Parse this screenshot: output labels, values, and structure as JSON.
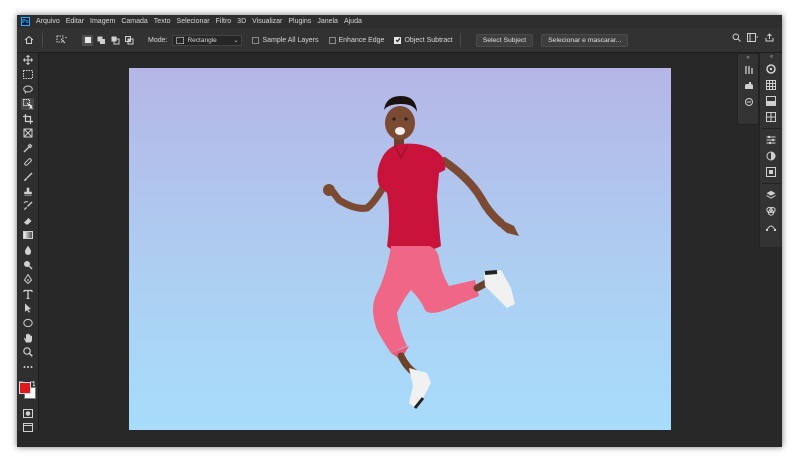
{
  "app": {
    "logo_text": "Ps",
    "accent": "#31a8ff"
  },
  "menubar": {
    "items": [
      "Arquivo",
      "Editar",
      "Imagem",
      "Camada",
      "Texto",
      "Selecionar",
      "Filtro",
      "3D",
      "Visualizar",
      "Plugins",
      "Janela",
      "Ajuda"
    ]
  },
  "options": {
    "mode_label": "Mode:",
    "mode_value": "Rectangle",
    "sample_all_layers": {
      "label": "Sample All Layers",
      "checked": false
    },
    "enhance_edge": {
      "label": "Enhance Edge",
      "checked": false
    },
    "object_subtract": {
      "label": "Object Subtract",
      "checked": true
    },
    "select_subject_label": "Select Subject",
    "select_mask_label": "Selecionar e mascarar..."
  },
  "toolbar": {
    "tools": [
      "move-icon",
      "marquee-icon",
      "lasso-icon",
      "object-selection-icon",
      "crop-icon",
      "frame-icon",
      "eyedropper-icon",
      "healing-brush-icon",
      "brush-icon",
      "clone-stamp-icon",
      "history-brush-icon",
      "eraser-icon",
      "gradient-icon",
      "blur-icon",
      "dodge-icon",
      "pen-icon",
      "type-icon",
      "path-selection-icon",
      "ellipse-icon",
      "hand-icon",
      "zoom-icon",
      "more-tools-icon"
    ],
    "active_tool": "object-selection-icon",
    "foreground_color": "#e01a1a",
    "background_color": "#ffffff"
  },
  "canvas": {
    "gradient_top": "#b5b6e6",
    "gradient_bottom": "#a7dcfb",
    "subject": "jumping man in red shirt and pink trousers"
  }
}
